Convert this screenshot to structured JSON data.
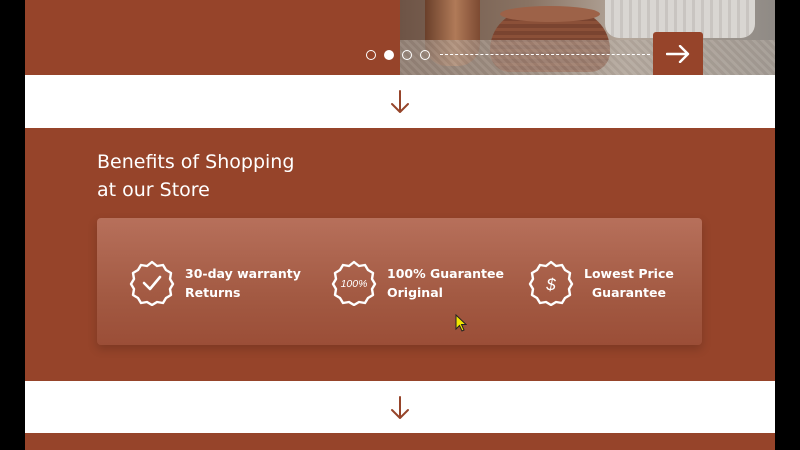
{
  "hero": {
    "carousel": {
      "slides": 4,
      "active_index": 1
    },
    "next_icon": "arrow-right-icon"
  },
  "scroll_icon": "arrow-down-icon",
  "benefits": {
    "title_line1": "Benefits of Shopping",
    "title_line2": "at our Store",
    "items": [
      {
        "icon": "check-badge-icon",
        "line1": "30-day warranty",
        "line2": "Returns"
      },
      {
        "icon": "percent-badge-icon",
        "badge_text": "100%",
        "line1": "100% Guarantee",
        "line2": "Original"
      },
      {
        "icon": "dollar-badge-icon",
        "badge_text": "$",
        "line1": "Lowest Price",
        "line2": "Guarantee"
      }
    ]
  },
  "colors": {
    "brand": "#96442a",
    "card": "#a35a43",
    "text_on_brand": "#ffffff",
    "arrow": "#96442a"
  }
}
